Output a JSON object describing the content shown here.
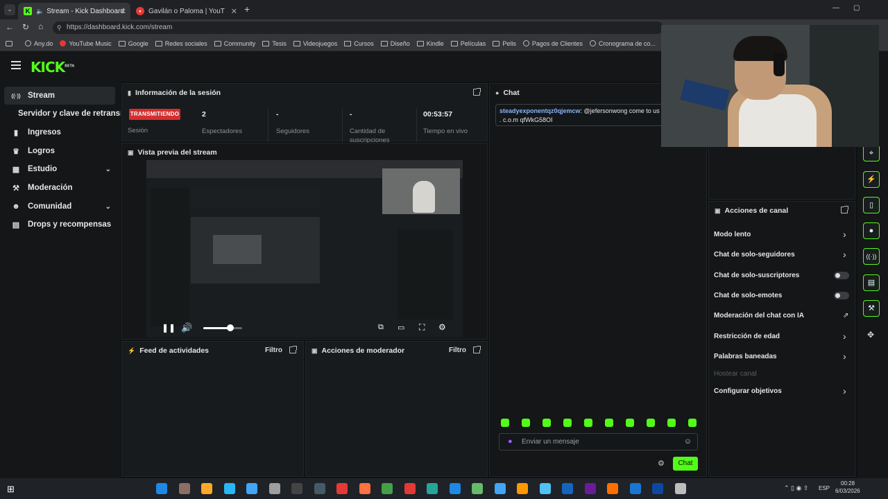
{
  "browser": {
    "tabs": [
      {
        "title": "Stream - Kick Dashboard",
        "active": true
      },
      {
        "title": "Gavilán o Paloma | YouTube N",
        "active": false
      }
    ],
    "url": "https://dashboard.kick.com/stream",
    "bookmarks": [
      "Any.do",
      "YouTube Music",
      "Google",
      "Redes sociales",
      "Community",
      "Tesis",
      "Videojuegos",
      "Cursos",
      "Diseño",
      "Kindle",
      "Películas",
      "Pelis",
      "Pagos de Clientes",
      "Cronograma de co..."
    ]
  },
  "app": {
    "logo": "KICK",
    "logo_badge": "BETA",
    "sidebar": [
      {
        "label": "Stream",
        "icon": "broadcast-icon",
        "glyph": "((·))",
        "active": true
      },
      {
        "label": "Servidor y clave de retransm",
        "icon": "",
        "glyph": ""
      },
      {
        "label": "Ingresos",
        "icon": "bar-chart-icon",
        "glyph": "▮▮"
      },
      {
        "label": "Logros",
        "icon": "trophy-icon",
        "glyph": "🏆"
      },
      {
        "label": "Estudio",
        "icon": "grid-icon",
        "glyph": "▦",
        "expandable": true
      },
      {
        "label": "Moderación",
        "icon": "wrench-icon",
        "glyph": "🔧"
      },
      {
        "label": "Comunidad",
        "icon": "people-icon",
        "glyph": "👥",
        "expandable": true
      },
      {
        "label": "Drops y recompensas",
        "icon": "gift-icon",
        "glyph": "▤"
      }
    ],
    "session": {
      "title": "Información de la sesión",
      "status_badge": "TRANSMITIENDO",
      "status_label": "Sesión",
      "stats": [
        {
          "value": "2",
          "label": "Espectadores"
        },
        {
          "value": "-",
          "label": "Seguidores"
        },
        {
          "value": "-",
          "label": "Cantidad de suscripciones"
        },
        {
          "value": "00:53:57",
          "label": "Tiempo en vivo"
        }
      ]
    },
    "preview": {
      "title": "Vista previa del stream",
      "volume": 0.7
    },
    "feed": {
      "title": "Feed de actividades",
      "filter": "Filtro"
    },
    "mod_actions": {
      "title": "Acciones de moderador",
      "filter": "Filtro"
    },
    "chat": {
      "title": "Chat",
      "messages": [
        {
          "user": "steadyexponentqz0qjemcw",
          "text": ": @jefersonwong come to us",
          "cont": ". c.o.m qfWkG58OI"
        }
      ],
      "input_placeholder": "Enviar un mensaje",
      "send_label": "Chat"
    },
    "channel_actions": {
      "title": "Acciones de canal",
      "items": [
        {
          "label": "Modo lento",
          "control": "arrow"
        },
        {
          "label": "Chat de solo-seguidores",
          "control": "arrow"
        },
        {
          "label": "Chat de solo-suscriptores",
          "control": "toggle"
        },
        {
          "label": "Chat de solo-emotes",
          "control": "toggle"
        },
        {
          "label": "Moderación del chat con IA",
          "control": "external"
        },
        {
          "label": "Restricción de edad",
          "control": "arrow"
        },
        {
          "label": "Palabras baneadas",
          "control": "arrow"
        },
        {
          "label": "Hostear canal",
          "control": "disabled"
        },
        {
          "label": "Configurar objetivos",
          "control": "arrow"
        }
      ]
    }
  },
  "taskbar": {
    "time": "00:28",
    "date": "6/03/2026",
    "lang": "ESP"
  },
  "colors": {
    "accent": "#53fc18",
    "live": "#d32f2f",
    "bg": "#0f1112",
    "panel": "#181b1d"
  }
}
